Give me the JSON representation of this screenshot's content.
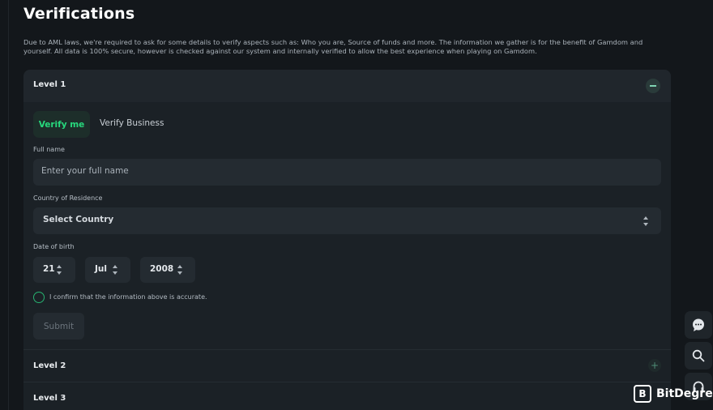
{
  "page": {
    "title": "Verifications",
    "description": "Due to AML laws, we're required to ask for some details to verify aspects such as: Who you are, Source of funds and more. The information we gather is for the benefit of Gamdom and yourself. All data is 100% secure, however is checked against our system and internally verified to allow the best experience when playing on Gamdom."
  },
  "levels": [
    {
      "label": "Level 1",
      "expanded": true
    },
    {
      "label": "Level 2",
      "expanded": false
    },
    {
      "label": "Level 3",
      "expanded": false
    }
  ],
  "tabs": {
    "verify_me": "Verify me",
    "verify_business": "Verify Business"
  },
  "form": {
    "full_name_label": "Full name",
    "full_name_placeholder": "Enter your full name",
    "country_label": "Country of Residence",
    "country_value": "Select Country",
    "dob_label": "Date of birth",
    "dob_day": "21",
    "dob_month": "Jul",
    "dob_year": "2008",
    "confirm_text": "I confirm that the information above is accurate.",
    "submit_label": "Submit"
  },
  "sidebar_icons": [
    "chat-icon",
    "search-icon",
    "headset-icon"
  ],
  "watermark": {
    "mark": "B",
    "text": "BitDegree"
  },
  "colors": {
    "background": "#13171b",
    "panel": "#1b2126",
    "accent": "#27d97d",
    "input": "#242b31"
  }
}
